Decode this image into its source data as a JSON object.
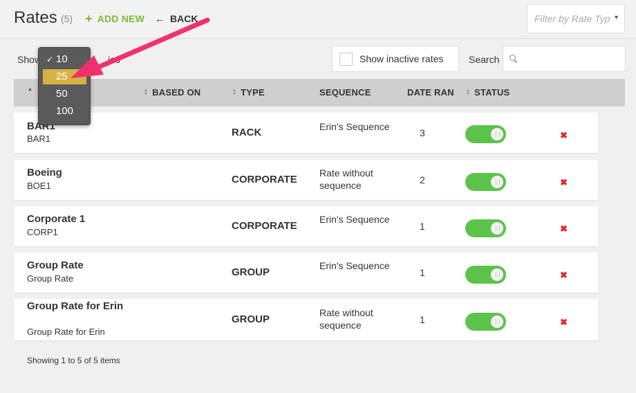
{
  "header": {
    "title": "Rates",
    "count": "(5)",
    "add_new": "ADD NEW",
    "back": "BACK",
    "filter_placeholder": "Filter by Rate Typ",
    "filter_caret": "▾"
  },
  "toolbar": {
    "show_prefix": "Show",
    "show_suffix": "ies",
    "show_inactive": "Show inactive rates",
    "search_label": "Search",
    "search_value": ""
  },
  "page_size_menu": {
    "options": [
      "10",
      "25",
      "50",
      "100"
    ],
    "checked": "10",
    "highlighted": "25",
    "check_glyph": "✓"
  },
  "table": {
    "columns": {
      "name": "",
      "based_on": "BASED ON",
      "type": "TYPE",
      "sequence": "SEQUENCE",
      "date_ran": "DATE RAN",
      "status": "STATUS"
    },
    "rows": [
      {
        "name": "BAR1",
        "code": "BAR1",
        "type": "RACK",
        "sequence": "Erin's Sequence",
        "date_ran": "3",
        "status_on": true,
        "delete": "✖"
      },
      {
        "name": "Boeing",
        "code": "BOE1",
        "type": "CORPORATE",
        "sequence": "Rate without sequence",
        "date_ran": "2",
        "status_on": true,
        "delete": "✖"
      },
      {
        "name": "Corporate 1",
        "code": "CORP1",
        "type": "CORPORATE",
        "sequence": "Erin's Sequence",
        "date_ran": "1",
        "status_on": true,
        "delete": "✖"
      },
      {
        "name": "Group Rate",
        "code": "Group Rate",
        "type": "GROUP",
        "sequence": "Erin's Sequence",
        "date_ran": "1",
        "status_on": true,
        "delete": "✖"
      },
      {
        "name": "Group Rate for Erin",
        "code": "Group Rate for Erin",
        "type": "GROUP",
        "sequence": "Rate without sequence",
        "date_ran": "1",
        "status_on": true,
        "delete": "✖"
      }
    ]
  },
  "footer": {
    "summary": "Showing 1 to 5 of 5 items"
  },
  "colors": {
    "accent_green": "#7cb93a",
    "toggle_green": "#5cc34a",
    "highlight": "#d6b244",
    "delete_red": "#e0252c",
    "arrow": "#f0316e"
  }
}
